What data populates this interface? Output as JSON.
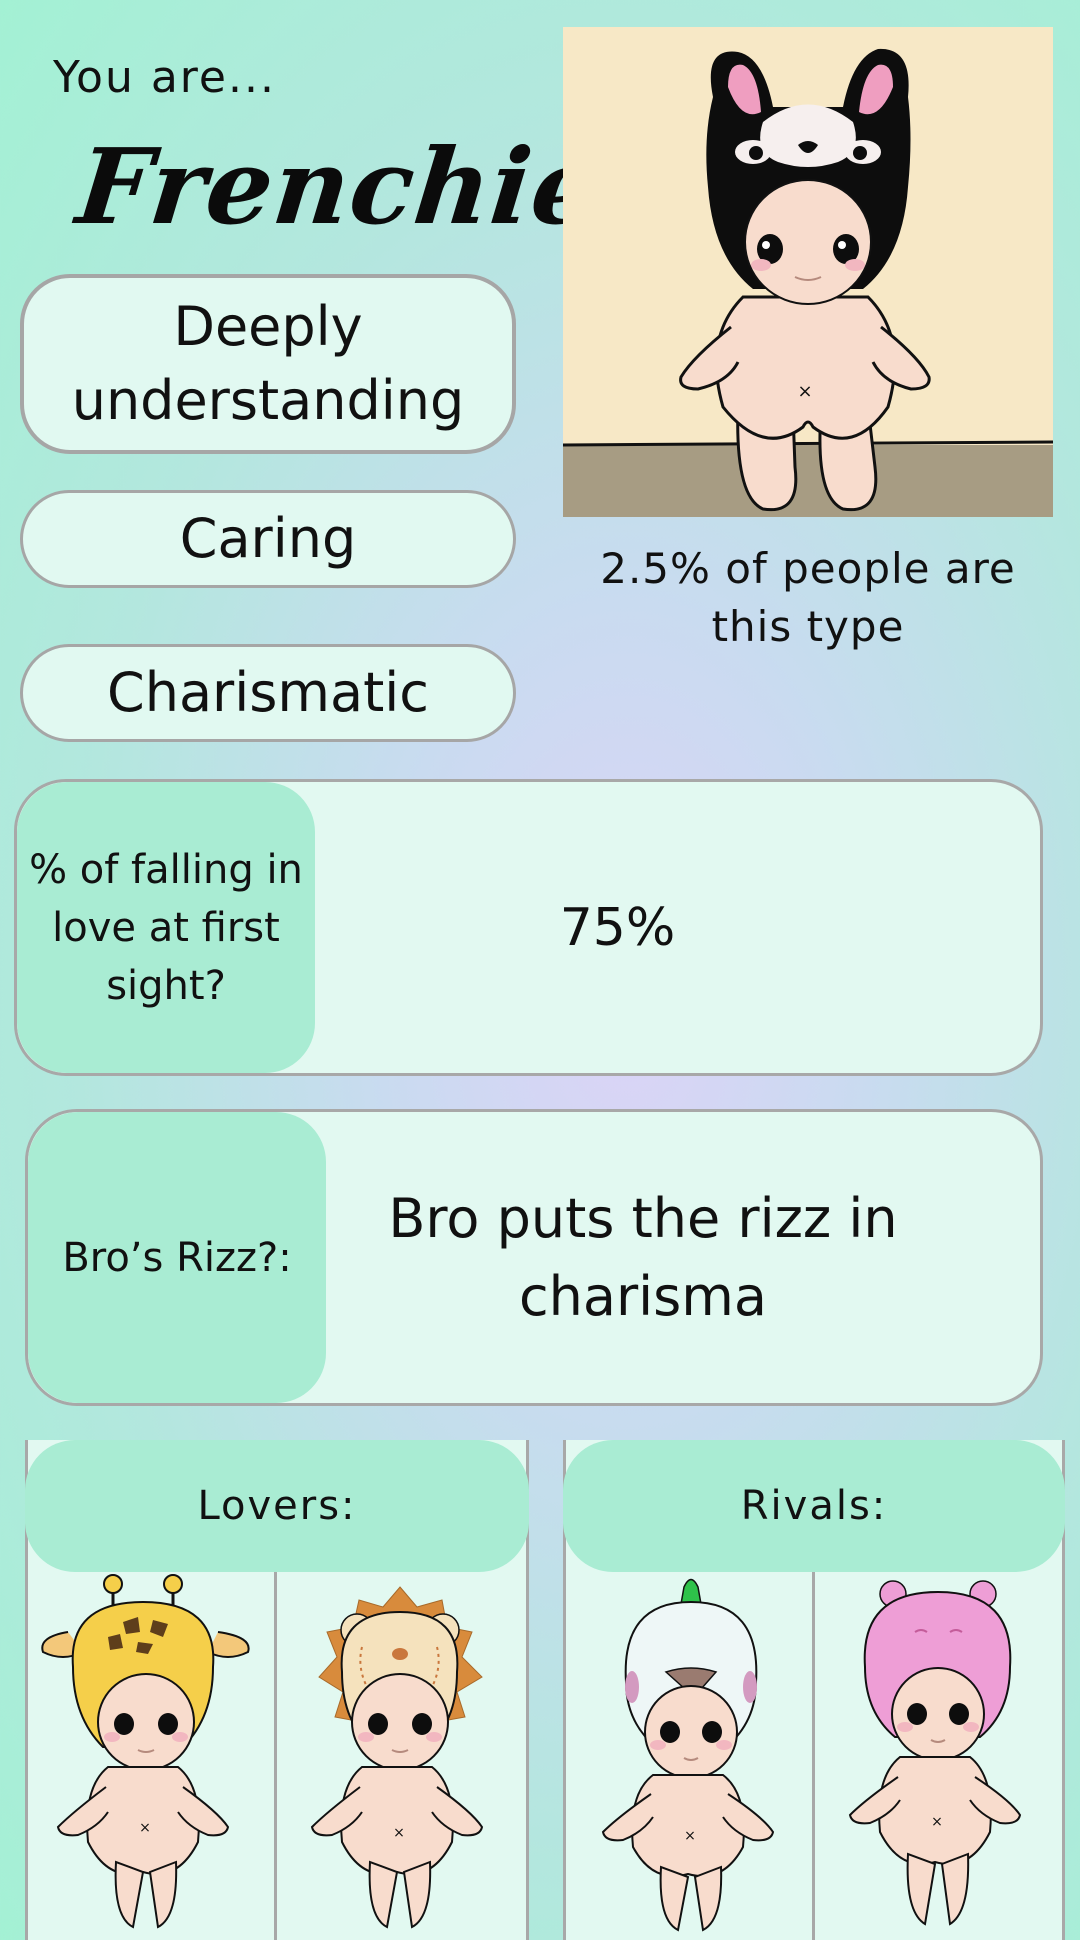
{
  "header": {
    "intro": "You are...",
    "type_name": "Frenchie!"
  },
  "traits": [
    "Deeply understanding",
    "Caring",
    "Charismatic"
  ],
  "rarity": "2.5% of people are this type",
  "stats": [
    {
      "label": "% of falling in love at first sight?",
      "value": "75%"
    },
    {
      "label": "Bro’s Rizz?:",
      "value": "Bro puts the rizz in charisma"
    }
  ],
  "lovers": {
    "label": "Lovers:",
    "figures": [
      "giraffe-figure",
      "lion-figure"
    ]
  },
  "rivals": {
    "label": "Rivals:",
    "figures": [
      "bird-figure",
      "hippo-figure"
    ]
  },
  "colors": {
    "accent": "#a9ecd3",
    "card": "#e2f9f1",
    "border": "#a8a8a8",
    "hero_bg": "#f7e8c6",
    "floor": "#a79c83"
  }
}
